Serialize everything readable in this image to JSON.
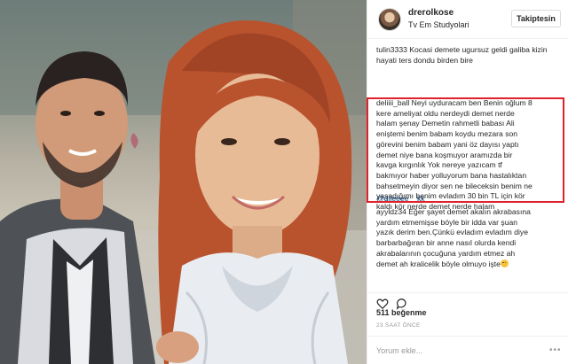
{
  "post": {
    "username": "drerolkose",
    "location": "Tv Em Studyolari",
    "follow_label": "Takiptesin"
  },
  "comments": {
    "c1": {
      "user": "tulin3333",
      "text": "Kocasi demete ugursuz geldi galiba kizin hayati ters dondu birden bire"
    },
    "c2": {
      "user": "deliiii_ball",
      "lines": [
        " Neyi uyduracam ben Benin oğlum 8",
        "kere ameliyat oldu nerdeydi demet nerde",
        "halam şenay Demetin rahmetli babası Ali",
        "eniştemi benim babam koydu mezara son",
        "görevini benim babam yani öz dayısı yaptı",
        "demet niye bana koşmuyor aramızda bir",
        "kavga kırgınlık Yok nereye yazıcam tf",
        "bakmıyor haber yolluyorum bana hastalıktan",
        "bahsetmeyin diyor sen ne bileceksin benim ne",
        "yaşadığımı benim evladım 30 bin TL için kör",
        "kaldı kör nerde demet nerde halam"
      ]
    },
    "c3": {
      "mention": "@dileeee__kk"
    },
    "c4": {
      "user": "ayyldz34",
      "lines": [
        " Eğer şayet demet akalın akrabasına",
        "yardım etmemişse böyle bir idda var şuan",
        "yazık derim ben.Çünkü evladım evladım diye",
        "barbarbağıran bir anne nasıl olurda kendi",
        "akrabalarının çocuğuna yardım etmez ah",
        "demet ah kralicelik böyle olmuyo işte"
      ],
      "emoji": "sad-face"
    }
  },
  "likes_label": "511 beğenme",
  "time_label": "23 SAAT ÖNCE",
  "comment_placeholder": "Yorum ekle...",
  "more_label": "•••",
  "colors": {
    "highlight": "#e0232b",
    "mention": "#003569",
    "meta": "#999999",
    "border": "#efefef"
  },
  "icons": [
    "heart-icon",
    "comment-icon",
    "avatar"
  ]
}
